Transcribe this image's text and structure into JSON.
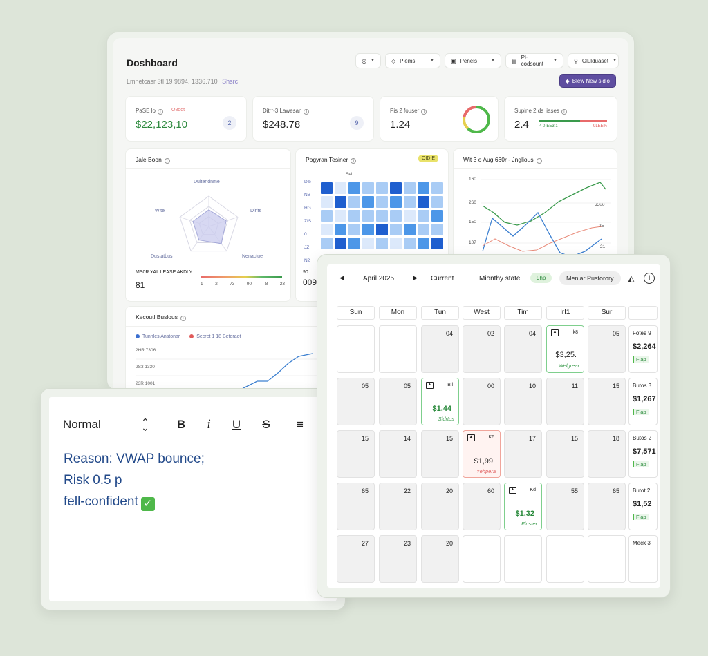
{
  "dashboard": {
    "title": "Doshboard",
    "subtitle": "Lmnetcasr 3tl 19 9894. 1336.710",
    "subtitle_link": "Shsrc",
    "filters": [
      {
        "label": ""
      },
      {
        "label": "Plems"
      },
      {
        "label": "Penels"
      },
      {
        "label": "PH codsount"
      },
      {
        "label": "Olulduaset"
      }
    ],
    "new_button": "Blew New sidio",
    "kpis": [
      {
        "label": "PaSE lo",
        "tag": "O8ddt",
        "value": "$22,123,10",
        "badge": "2",
        "value_color": "#2d8a3e"
      },
      {
        "label": "Ditrr-3 Lawesan",
        "tag": "",
        "value": "$248.78",
        "badge": "9",
        "value_color": "#222222"
      },
      {
        "label": "Pis 2 fouser",
        "tag": "",
        "value": "1.24",
        "badge": "",
        "value_color": "#222222"
      },
      {
        "label": "Supine 2 ds liases",
        "tag": "",
        "value": "2.4",
        "badge": "",
        "value_color": "#222222",
        "bar_left": "4 0-EE3.1",
        "bar_right": "9LEE%"
      }
    ],
    "radar_card": {
      "title": "Jale Boon",
      "axes": [
        "Dultendnme",
        "Dirits",
        "Nenactue",
        "Dustatbus",
        "Wite"
      ],
      "values": [
        0.55,
        0.6,
        0.7,
        0.55,
        0.55
      ],
      "footer_label": "MS0R YAL LEASE AKDLY",
      "footer_value": "81",
      "scale_ticks": [
        "1",
        "2",
        "73",
        "90",
        "-8",
        "23"
      ]
    },
    "heatmap_card": {
      "title": "Pogyran Tesiner",
      "badge": "OIDIE",
      "header": "Sel",
      "row_labels": [
        "Dlb",
        "NB",
        "HG",
        "ZIS",
        "0",
        "JZ",
        "N2"
      ],
      "cells": [
        [
          3,
          0,
          2,
          1,
          1,
          3,
          1,
          2,
          1
        ],
        [
          0,
          3,
          1,
          2,
          1,
          2,
          1,
          3,
          1
        ],
        [
          1,
          0,
          1,
          1,
          1,
          1,
          0,
          1,
          2
        ],
        [
          0,
          2,
          1,
          2,
          3,
          1,
          2,
          1,
          1
        ],
        [
          1,
          3,
          2,
          0,
          1,
          0,
          1,
          2,
          3
        ]
      ],
      "footer_label": "90",
      "footer_value": "009"
    },
    "line_card": {
      "title": "Wit 3 o Aug 660r - Jnglious",
      "y_labels": [
        "160",
        "260",
        "150",
        "107"
      ],
      "right_labels": [
        "3500",
        "25",
        "21"
      ]
    },
    "lower_card": {
      "title": "Kecoutl Buslous",
      "legend": [
        {
          "label": "Tunnles Anstonar",
          "color": "#3b6fd0"
        },
        {
          "label": "Secret 1 18 Beteraot",
          "color": "#e05a5a"
        }
      ],
      "y_labels": [
        "2HR 7306",
        "2S3 1330",
        "23R 1001"
      ]
    }
  },
  "editor": {
    "style": "Normal",
    "lines": [
      "Reason: VWAP bounce;",
      "Risk 0.5 p",
      "fell-confident"
    ]
  },
  "calendar": {
    "month": "April 2025",
    "current": "Current",
    "monthly_state": "Mionthy state",
    "green_pill": "9hp",
    "gray_pill": "Menlar Pustorory",
    "days_of_week": [
      "Sun",
      "Mon",
      "Tun",
      "West",
      "Tim",
      "lrI1",
      "Sur"
    ],
    "weeks": [
      [
        {
          "num": "",
          "kind": "blank"
        },
        {
          "num": "",
          "kind": "blank"
        },
        {
          "num": "04",
          "kind": "plain"
        },
        {
          "num": "02",
          "kind": "plain"
        },
        {
          "num": "04",
          "kind": "plain"
        },
        {
          "num": "",
          "kind": "win",
          "sm": "k8",
          "amt": "$3,25.",
          "tr": "Welgrear"
        },
        {
          "num": "05",
          "kind": "plain"
        }
      ],
      [
        {
          "num": "05",
          "kind": "plain"
        },
        {
          "num": "05",
          "kind": "plain"
        },
        {
          "num": "",
          "kind": "win",
          "sm": "Bil",
          "amt": "$1,44",
          "tr": "Sldrtos"
        },
        {
          "num": "00",
          "kind": "plain"
        },
        {
          "num": "10",
          "kind": "plain"
        },
        {
          "num": "11",
          "kind": "plain"
        },
        {
          "num": "15",
          "kind": "plain"
        }
      ],
      [
        {
          "num": "15",
          "kind": "plain"
        },
        {
          "num": "14",
          "kind": "plain"
        },
        {
          "num": "15",
          "kind": "plain"
        },
        {
          "num": "",
          "kind": "loss",
          "sm": "K6",
          "amt": "$1,99",
          "tr": "Yehpera"
        },
        {
          "num": "17",
          "kind": "plain"
        },
        {
          "num": "15",
          "kind": "plain"
        },
        {
          "num": "18",
          "kind": "plain"
        }
      ],
      [
        {
          "num": "65",
          "kind": "plain"
        },
        {
          "num": "22",
          "kind": "plain"
        },
        {
          "num": "20",
          "kind": "plain"
        },
        {
          "num": "60",
          "kind": "plain"
        },
        {
          "num": "",
          "kind": "win",
          "sm": "Kd",
          "amt": "$1,32",
          "tr": "Fluster"
        },
        {
          "num": "55",
          "kind": "plain"
        },
        {
          "num": "65",
          "kind": "plain"
        }
      ],
      [
        {
          "num": "27",
          "kind": "plain"
        },
        {
          "num": "23",
          "kind": "plain"
        },
        {
          "num": "20",
          "kind": "plain"
        },
        {
          "num": "",
          "kind": "blank"
        },
        {
          "num": "",
          "kind": "blank"
        },
        {
          "num": "",
          "kind": "blank"
        },
        {
          "num": "",
          "kind": "blank"
        }
      ]
    ],
    "week_summaries": [
      {
        "label": "Fotes 9",
        "value": "$2,264",
        "tag": "Flap"
      },
      {
        "label": "Butos 3",
        "value": "$1,267",
        "tag": "Flap"
      },
      {
        "label": "Butos 2",
        "value": "$7,571",
        "tag": "Flap"
      },
      {
        "label": "Butot 2",
        "value": "$1,52",
        "tag": "Flap"
      },
      {
        "label": "Meck 3",
        "value": "",
        "tag": ""
      }
    ]
  }
}
